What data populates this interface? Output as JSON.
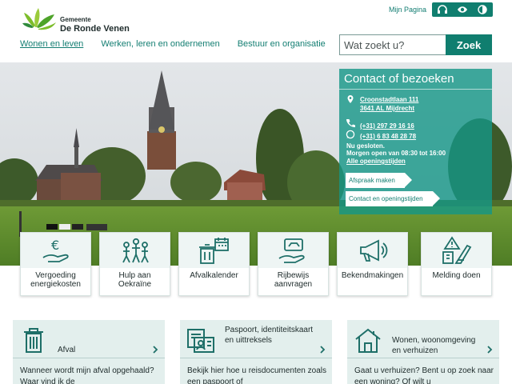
{
  "header": {
    "logo_line1": "Gemeente",
    "logo_line2": "De Ronde Venen",
    "my_page": "Mijn Pagina",
    "tools": [
      "headphones-icon",
      "eye-icon",
      "contrast-icon"
    ]
  },
  "nav": {
    "items": [
      {
        "label": "Wonen en leven",
        "active": true
      },
      {
        "label": "Werken, leren en ondernemen",
        "active": false
      },
      {
        "label": "Bestuur en organisatie",
        "active": false
      }
    ]
  },
  "search": {
    "placeholder": "Wat zoekt u?",
    "button": "Zoek"
  },
  "contact": {
    "title": "Contact of bezoeken",
    "address_line1": "Croonstadtlaan 111",
    "address_line2": "3641 AL Mijdrecht",
    "phone": "(+31) 297 29 16 16",
    "whatsapp": "(+31) 6 83 48 28 78",
    "status_closed": "Nu gesloten.",
    "status_open": "Morgen open van 08:30 tot 16:00",
    "hours_link": "Alle openingstijden",
    "btn_appointment": "Afspraak maken",
    "btn_contact": "Contact en openingstijden"
  },
  "tiles": [
    {
      "label": "Vergoeding energiekosten",
      "icon": "euro-hand-icon"
    },
    {
      "label": "Hulp aan Oekraïne",
      "icon": "family-icon"
    },
    {
      "label": "Afvalkalender",
      "icon": "bin-calendar-icon"
    },
    {
      "label": "Rijbewijs aanvragen",
      "icon": "license-hand-icon"
    },
    {
      "label": "Bekendmakingen",
      "icon": "megaphone-icon"
    },
    {
      "label": "Melding doen",
      "icon": "warning-report-icon"
    }
  ],
  "cards": [
    {
      "title": "Afval",
      "icon": "trash-icon",
      "text": "Wanneer wordt mijn afval opgehaald? Waar vind ik de"
    },
    {
      "title": "Paspoort, identiteitskaart en uittreksels",
      "icon": "id-card-icon",
      "text": "Bekijk hier hoe u reisdocumenten zoals een paspoort of"
    },
    {
      "title": "Wonen, woonomgeving en verhuizen",
      "icon": "house-icon",
      "text": "Gaat u verhuizen? Bent u op zoek naar een woning? Of wilt u"
    }
  ],
  "colors": {
    "primary": "#107e6f",
    "link": "#137e72",
    "tile_bg": "#eef5f4",
    "card_bg": "#e3efed"
  }
}
